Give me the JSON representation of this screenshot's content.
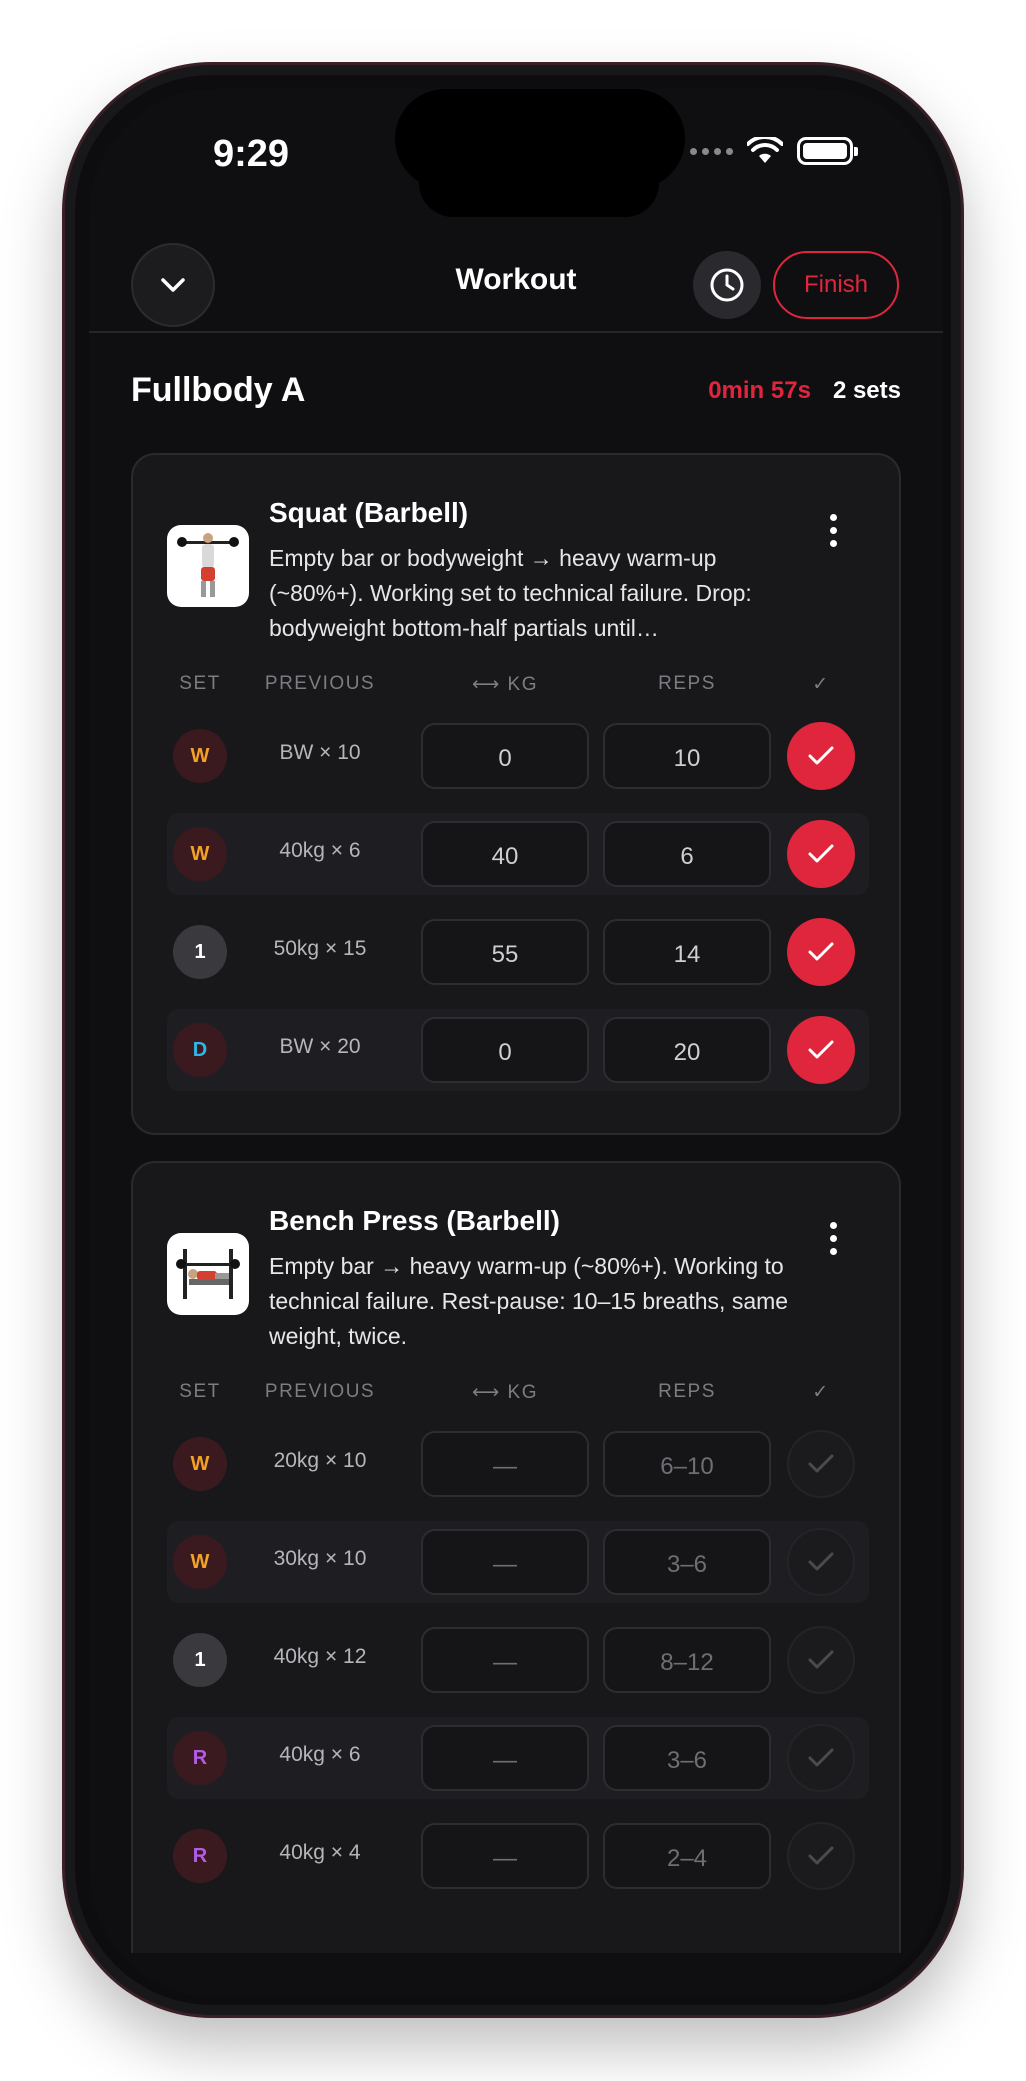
{
  "status_bar": {
    "time": "9:29"
  },
  "header": {
    "title": "Workout",
    "finish_label": "Finish"
  },
  "workout": {
    "name": "Fullbody A",
    "elapsed": "0min 57s",
    "sets_count": "2 sets"
  },
  "columns": {
    "set": "SET",
    "previous": "PREVIOUS",
    "kg": "⟷ KG",
    "reps": "REPS",
    "done": "✓"
  },
  "exercises": [
    {
      "title": "Squat (Barbell)",
      "notes": "Empty bar or bodyweight → heavy warm-up (~80%+). Working set to technical failure. Drop: bodyweight bottom-half partials until…",
      "sets": [
        {
          "label": "W",
          "previous": "BW × 10",
          "kg": "0",
          "reps": "10",
          "done": true
        },
        {
          "label": "W",
          "previous": "40kg × 6",
          "kg": "40",
          "reps": "6",
          "done": true
        },
        {
          "label": "1",
          "previous": "50kg × 15",
          "kg": "55",
          "reps": "14",
          "done": true
        },
        {
          "label": "D",
          "previous": "BW × 20",
          "kg": "0",
          "reps": "20",
          "done": true
        }
      ]
    },
    {
      "title": "Bench Press (Barbell)",
      "notes": "Empty bar → heavy warm-up (~80%+). Working to technical failure. Rest-pause: 10–15 breaths, same weight, twice.",
      "sets": [
        {
          "label": "W",
          "previous": "20kg × 10",
          "kg": "—",
          "reps": "6–10",
          "done": false
        },
        {
          "label": "W",
          "previous": "30kg × 10",
          "kg": "—",
          "reps": "3–6",
          "done": false
        },
        {
          "label": "1",
          "previous": "40kg × 12",
          "kg": "—",
          "reps": "8–12",
          "done": false
        },
        {
          "label": "R",
          "previous": "40kg × 6",
          "kg": "—",
          "reps": "3–6",
          "done": false
        },
        {
          "label": "R",
          "previous": "40kg × 4",
          "kg": "—",
          "reps": "2–4",
          "done": false
        }
      ]
    }
  ],
  "colors": {
    "accent": "#e0263d",
    "warmup": "#f2a227",
    "drop": "#2fb6e8",
    "restpause": "#b45be8"
  }
}
